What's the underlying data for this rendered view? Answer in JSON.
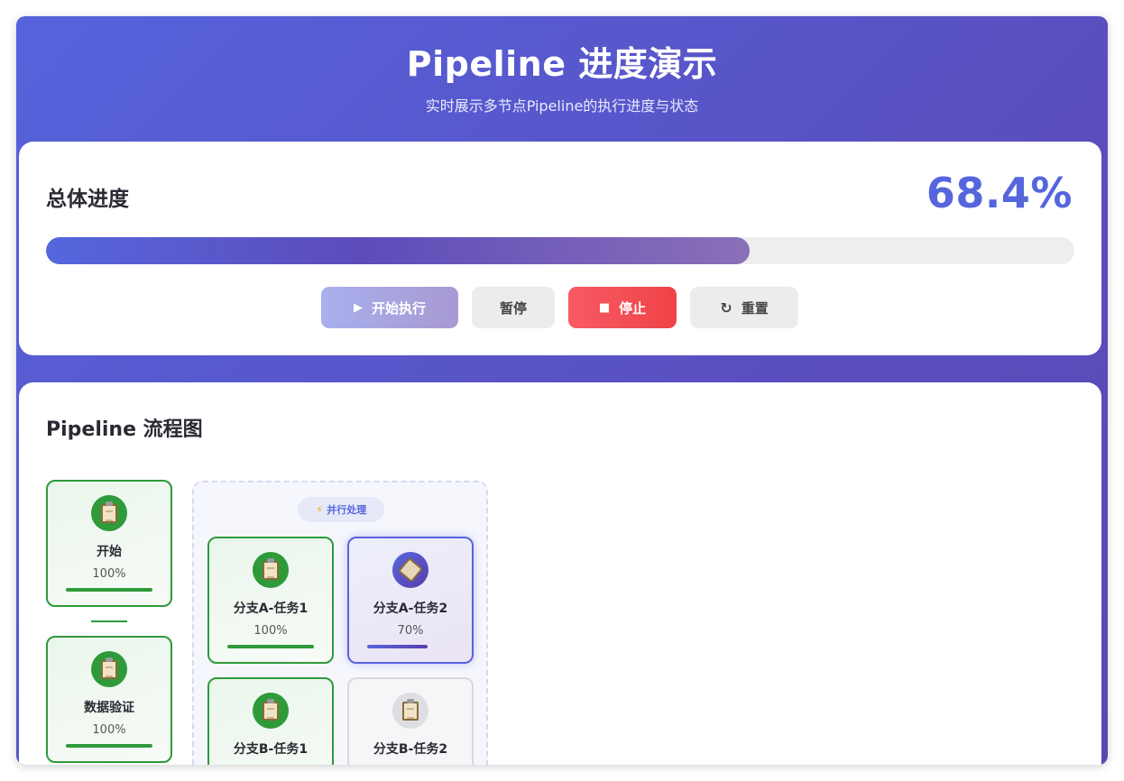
{
  "header": {
    "title": "Pipeline 进度演示",
    "subtitle": "实时展示多节点Pipeline的执行进度与状态"
  },
  "overall": {
    "label": "总体进度",
    "percent_text": "68.4%",
    "progress_fraction": 0.684
  },
  "controls": {
    "start_label": "开始执行",
    "pause_label": "暂停",
    "stop_label": "停止",
    "reset_label": "重置",
    "start_icon": "play-icon",
    "stop_icon": "stop-icon",
    "reset_icon": "refresh-icon"
  },
  "flow": {
    "title": "Pipeline 流程图",
    "parallel_label": "并行处理",
    "parallel_icon": "lightning-icon",
    "nodes": [
      {
        "name": "开始",
        "percent": "100%",
        "progress": 1.0,
        "status": "done",
        "icon": "clipboard-icon"
      },
      {
        "name": "数据验证",
        "percent": "100%",
        "progress": 1.0,
        "status": "done",
        "icon": "clipboard-icon"
      }
    ],
    "parallel_nodes": [
      {
        "name": "分支A-任务1",
        "percent": "100%",
        "progress": 1.0,
        "status": "done",
        "icon": "clipboard-icon"
      },
      {
        "name": "分支A-任务2",
        "percent": "70%",
        "progress": 0.7,
        "status": "running",
        "icon": "clipboard-icon"
      },
      {
        "name": "分支B-任务1",
        "percent": "",
        "progress": 1.0,
        "status": "done",
        "icon": "clipboard-icon"
      },
      {
        "name": "分支B-任务2",
        "percent": "",
        "progress": 0,
        "status": "pending",
        "icon": "clipboard-icon"
      }
    ]
  },
  "colors": {
    "accent": "#5566dd",
    "success": "#2e9a3a",
    "danger": "#ee4347"
  }
}
